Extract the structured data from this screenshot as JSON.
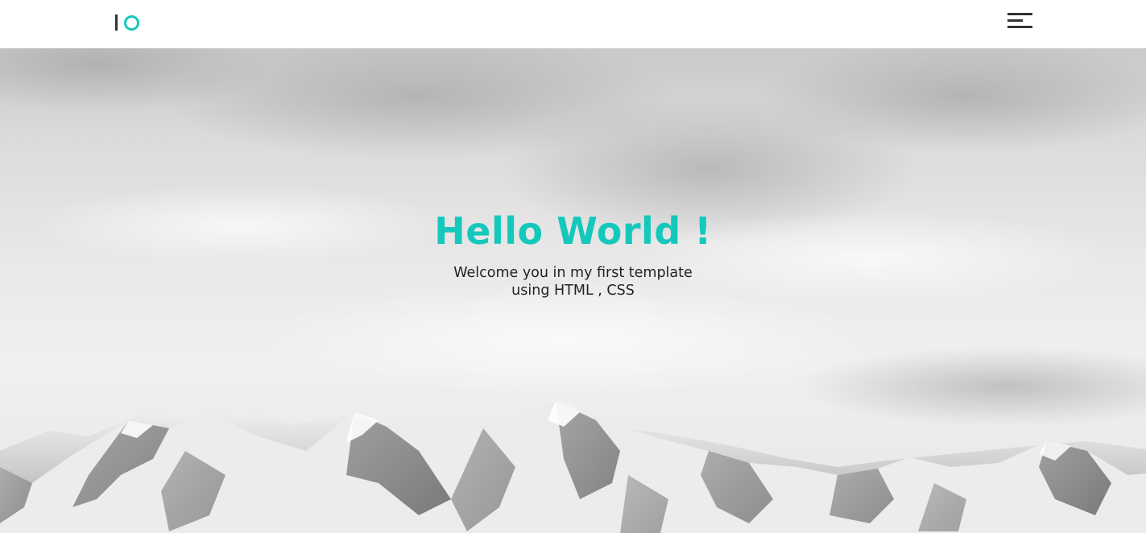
{
  "header": {
    "logo_name": "io-logo",
    "menu_icon": "hamburger-menu-icon"
  },
  "hero": {
    "title": "Hello World !",
    "subtitle": "Welcome you in my first template using HTML , CSS",
    "background": "black-and-white snowy mountains under cloudy sky"
  },
  "colors": {
    "accent": "#14c8bc",
    "text_dark": "#222222",
    "icon_dark": "#333333",
    "header_bg": "#ffffff"
  }
}
